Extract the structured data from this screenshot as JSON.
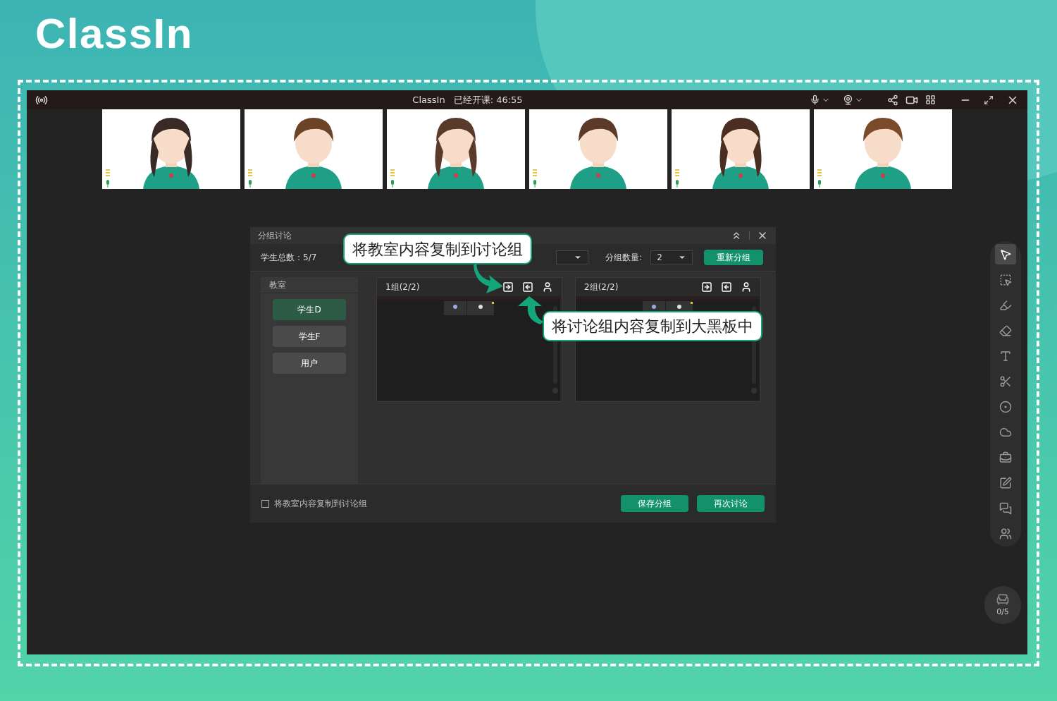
{
  "brand": "ClassIn",
  "title_bar": {
    "app": "ClassIn",
    "status": "已经开课: 46:55"
  },
  "dialog": {
    "title": "分组讨论",
    "student_total_label": "学生总数：",
    "student_total": "5/7",
    "group_count_label": "分组数量:",
    "group_count": "2",
    "regroup_button": "重新分组",
    "classroom": {
      "title": "教室",
      "students": [
        {
          "name": "学生D",
          "selected": true
        },
        {
          "name": "学生F",
          "selected": false
        },
        {
          "name": "用户",
          "selected": false
        }
      ]
    },
    "groups": [
      {
        "title": "1组(2/2)"
      },
      {
        "title": "2组(2/2)"
      }
    ],
    "copy_option": {
      "label": "将教室内容复制到讨论组",
      "checked": false
    },
    "buttons": [
      "保存分组",
      "再次讨论"
    ]
  },
  "callouts": [
    {
      "text": "将教室内容复制到讨论组"
    },
    {
      "text": "将讨论组内容复制到大黑板中"
    }
  ],
  "toolbar": [
    {
      "kind": "pointer",
      "selected": true
    },
    {
      "kind": "select",
      "selected": false
    },
    {
      "kind": "laser",
      "selected": false
    },
    {
      "kind": "eraser",
      "selected": false
    },
    {
      "kind": "text",
      "selected": false
    },
    {
      "kind": "scissors",
      "selected": false
    },
    {
      "kind": "shape",
      "selected": false
    },
    {
      "kind": "cloud",
      "selected": false
    },
    {
      "kind": "toolbox",
      "selected": false
    },
    {
      "kind": "edit",
      "selected": false
    },
    {
      "kind": "chat",
      "selected": false
    },
    {
      "kind": "users",
      "selected": false
    }
  ],
  "seat_counter": "0/5"
}
